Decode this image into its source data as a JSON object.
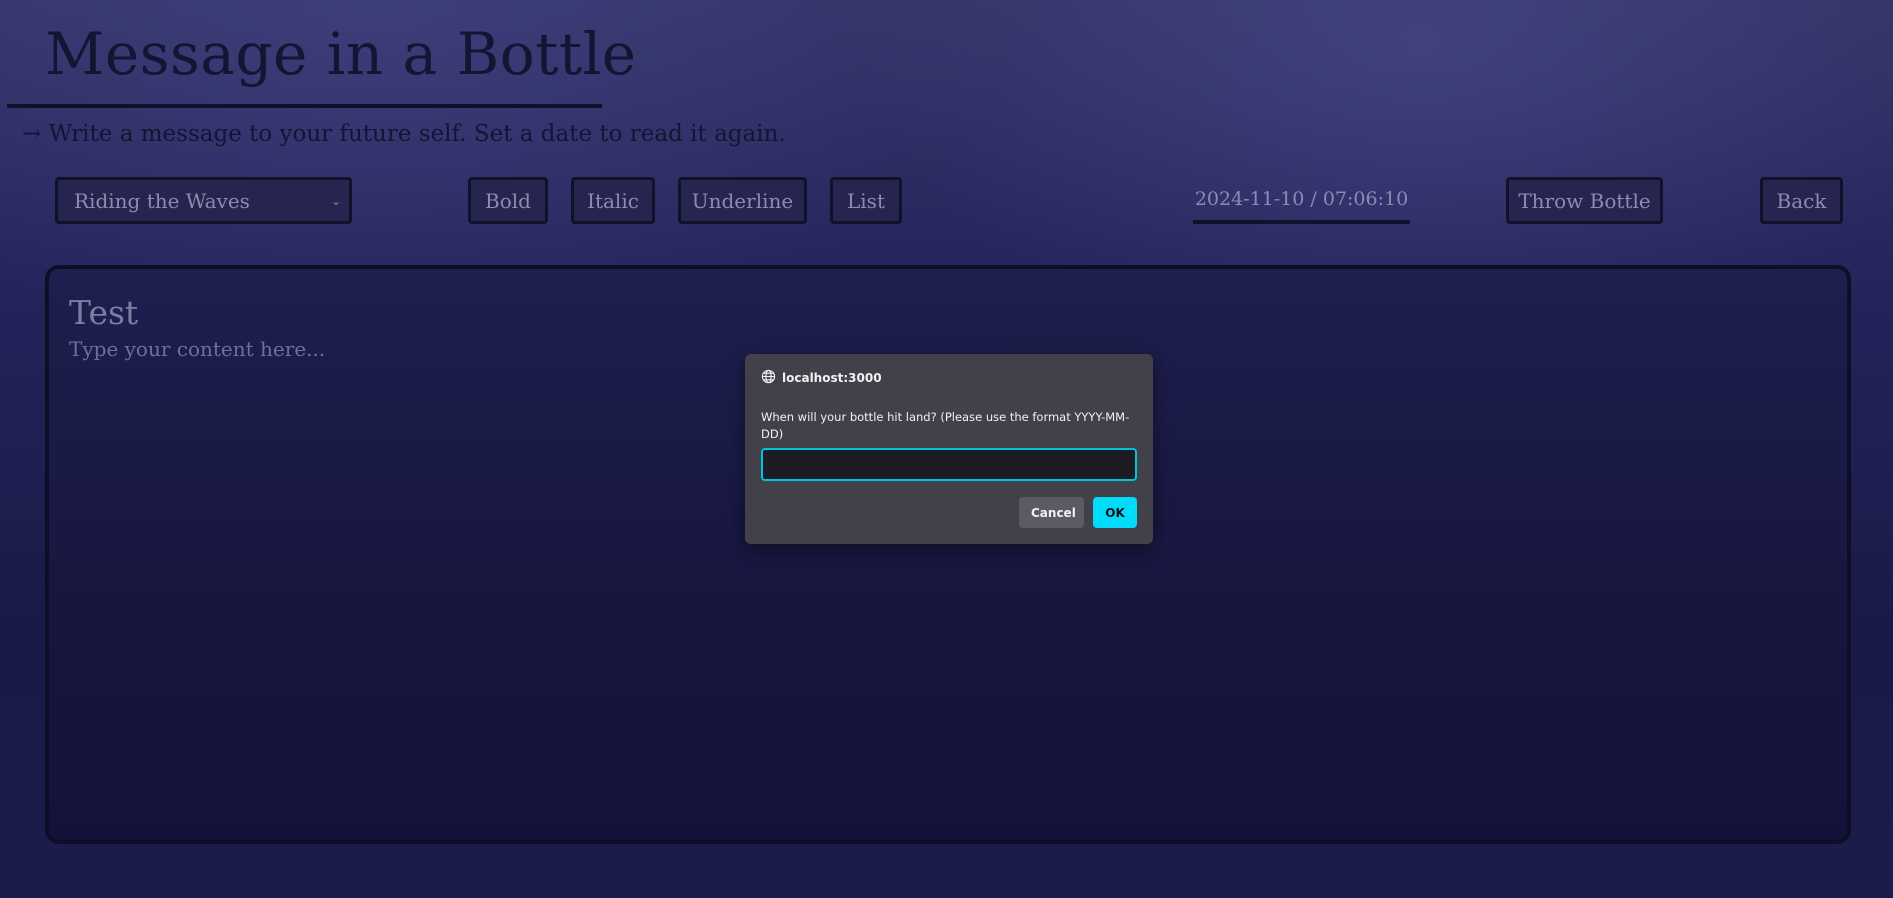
{
  "header": {
    "title": "Message in a Bottle",
    "subtitle": "→ Write a message to your future self. Set a date to read it again."
  },
  "toolbar": {
    "theme_select": {
      "selected": "Riding the Waves"
    },
    "bold_label": "Bold",
    "italic_label": "Italic",
    "underline_label": "Underline",
    "list_label": "List",
    "datetime": "2024-11-10 / 07:06:10",
    "throw_label": "Throw Bottle",
    "back_label": "Back"
  },
  "editor": {
    "title": "Test",
    "body_placeholder": "Type your content here..."
  },
  "dialog": {
    "origin": "localhost:3000",
    "message": "When will your bottle hit land? (Please use the format YYYY-MM-DD)",
    "input_value": "",
    "cancel_label": "Cancel",
    "ok_label": "OK",
    "icons": {
      "origin": "globe-icon"
    },
    "colors": {
      "accent": "#00dbf8",
      "focus_border": "#00c4dc"
    }
  },
  "colors": {
    "background": "#23235a",
    "title_text": "#141433",
    "control_text": "#8b8cb0"
  }
}
